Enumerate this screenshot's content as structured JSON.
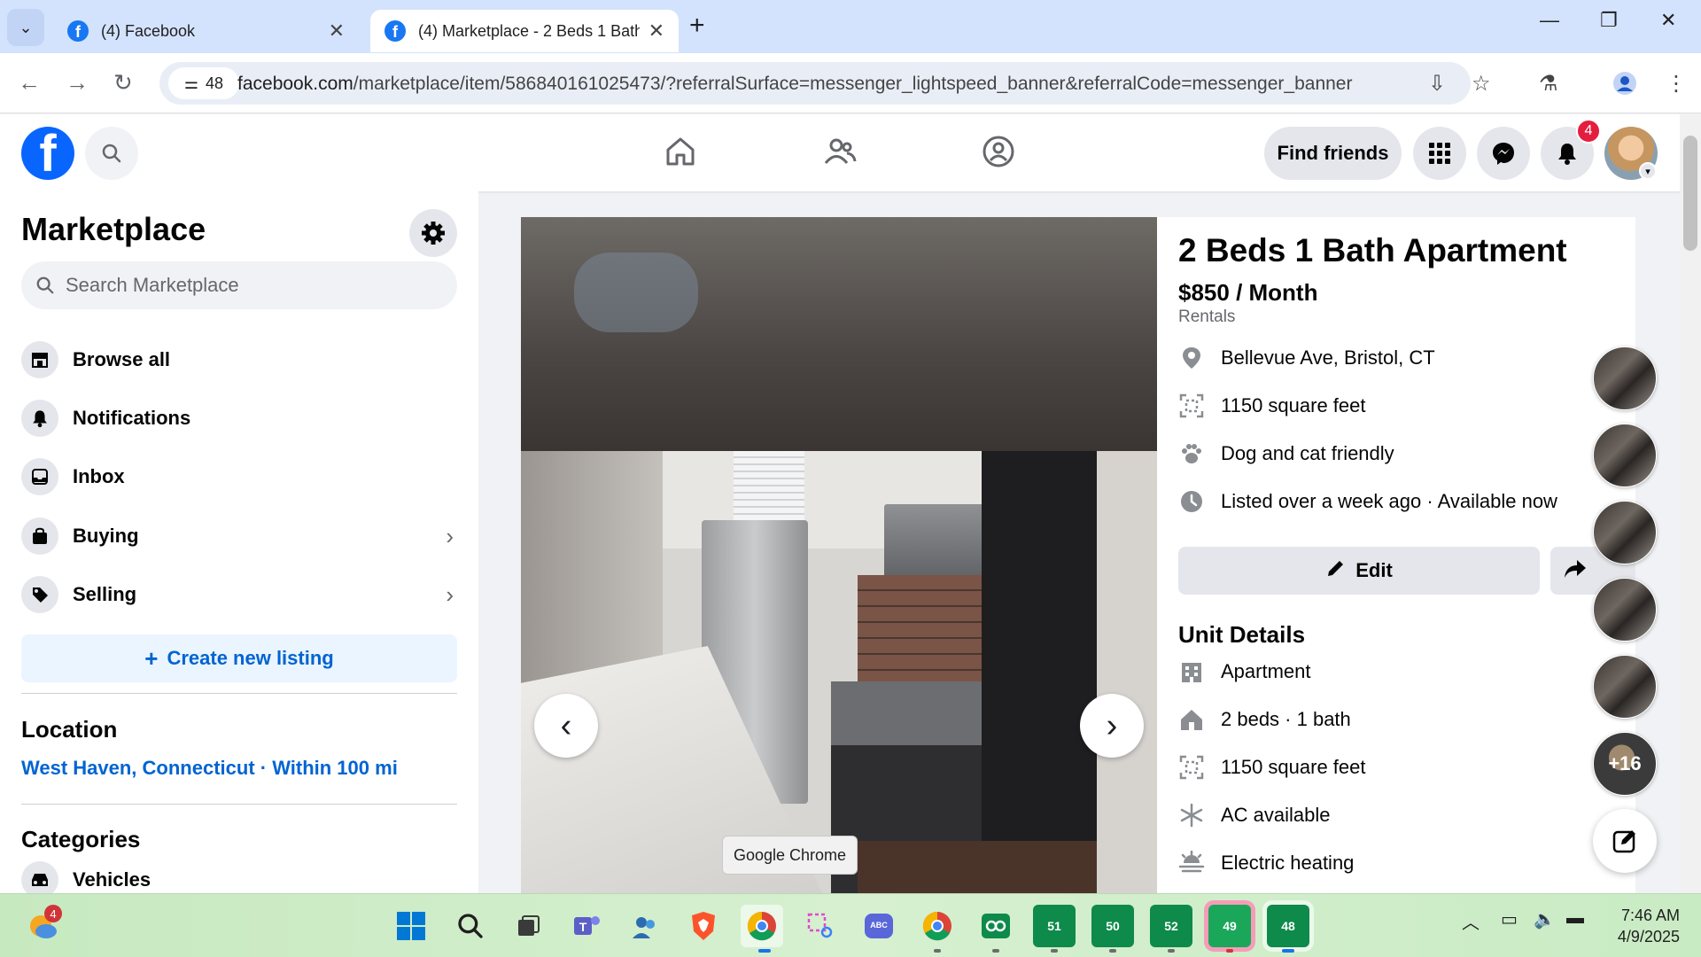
{
  "browser": {
    "tabs": [
      {
        "title": "(4) Facebook"
      },
      {
        "title": "(4) Marketplace - 2 Beds 1 Bath"
      }
    ],
    "site_info_count": "48",
    "url_host": "facebook.com",
    "url_path": "/marketplace/item/586840161025473/?referralSurface=messenger_lightspeed_banner&referralCode=messenger_banner"
  },
  "header": {
    "find_friends_label": "Find friends",
    "notification_count": "4"
  },
  "sidebar": {
    "title": "Marketplace",
    "search_placeholder": "Search Marketplace",
    "items": [
      {
        "label": "Browse all",
        "icon": "store-icon"
      },
      {
        "label": "Notifications",
        "icon": "bell-icon"
      },
      {
        "label": "Inbox",
        "icon": "inbox-icon"
      },
      {
        "label": "Buying",
        "icon": "shopping-bag-icon"
      },
      {
        "label": "Selling",
        "icon": "price-tag-icon"
      }
    ],
    "create_listing_label": "Create new listing",
    "location_heading": "Location",
    "location_value": "West Haven, Connecticut · Within 100 mi",
    "categories_heading": "Categories",
    "first_category": "Vehicles"
  },
  "listing": {
    "title": "2 Beds 1 Bath Apartment",
    "price": "$850 / Month",
    "category": "Rentals",
    "facts": [
      {
        "text": "Bellevue Ave, Bristol, CT",
        "icon": "location-pin-icon"
      },
      {
        "text": "1150 square feet",
        "icon": "area-icon"
      },
      {
        "text": "Dog and cat friendly",
        "icon": "paw-icon"
      },
      {
        "text": "Listed over a week ago · Available now",
        "icon": "clock-icon"
      }
    ],
    "edit_label": "Edit",
    "unit_details_heading": "Unit Details",
    "unit_details": [
      {
        "text": "Apartment",
        "icon": "building-icon"
      },
      {
        "text": "2 beds · 1 bath",
        "icon": "home-icon"
      },
      {
        "text": "1150 square feet",
        "icon": "area-icon"
      },
      {
        "text": "AC available",
        "icon": "snowflake-icon"
      },
      {
        "text": "Electric heating",
        "icon": "heating-icon"
      }
    ]
  },
  "photo_tooltip": "Google Chrome",
  "chatheads_more": "+16",
  "taskbar": {
    "weather_badge": "4",
    "numbered_apps": [
      "51",
      "50",
      "52",
      "49",
      "48"
    ],
    "time": "7:46 AM",
    "date": "4/9/2025"
  },
  "colors": {
    "fb_blue": "#0866ff",
    "link_blue": "#0064d1",
    "badge_red": "#e41e3f"
  }
}
